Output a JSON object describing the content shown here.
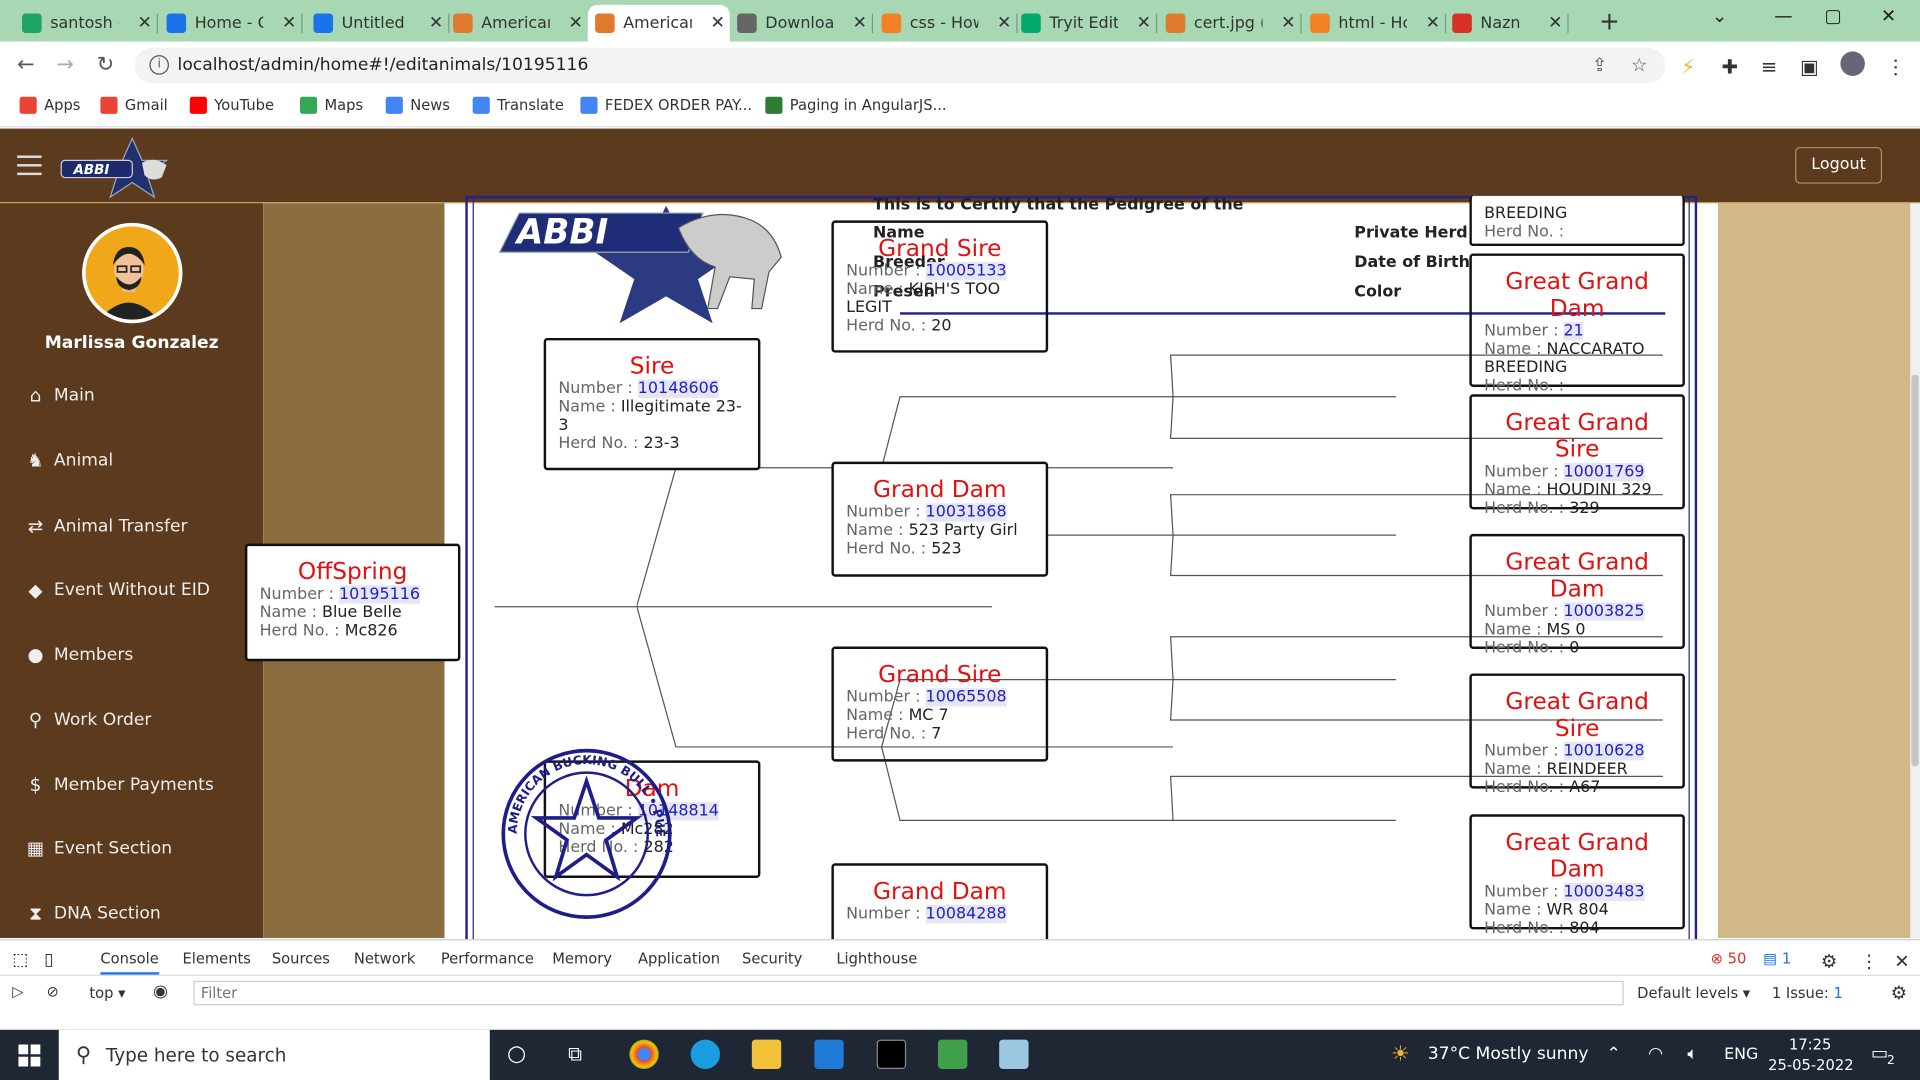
{
  "browser": {
    "tabs": [
      {
        "title": "santosh c",
        "favicon_color": "#1ea362",
        "active": false
      },
      {
        "title": "Home - C",
        "favicon_color": "#1a73e8",
        "active": false
      },
      {
        "title": "Untitled c",
        "favicon_color": "#1a73e8",
        "active": false
      },
      {
        "title": "American",
        "favicon_color": "#e07a2e",
        "active": false
      },
      {
        "title": "American",
        "favicon_color": "#e07a2e",
        "active": true
      },
      {
        "title": "Downloa",
        "favicon_color": "#666666",
        "active": false
      },
      {
        "title": "css - How",
        "favicon_color": "#f48024",
        "active": false
      },
      {
        "title": "Tryit Edit",
        "favicon_color": "#04aa6d",
        "active": false
      },
      {
        "title": "cert.jpg (",
        "favicon_color": "#e07a2e",
        "active": false
      },
      {
        "title": "html - Hc",
        "favicon_color": "#f48024",
        "active": false
      },
      {
        "title": "Nazn",
        "favicon_color": "#d93025",
        "active": false
      }
    ],
    "new_tab": "+",
    "url": "localhost/admin/home#!/editanimals/10195116",
    "bookmarks": [
      {
        "label": "Apps",
        "color": "#ea4335"
      },
      {
        "label": "Gmail",
        "color": "#ea4335"
      },
      {
        "label": "YouTube",
        "color": "#ff0000"
      },
      {
        "label": "Maps",
        "color": "#34a853"
      },
      {
        "label": "News",
        "color": "#4285f4"
      },
      {
        "label": "Translate",
        "color": "#4285f4"
      },
      {
        "label": "FEDEX ORDER PAY...",
        "color": "#4285f4"
      },
      {
        "label": "Paging in AngularJS...",
        "color": "#2e7d32"
      }
    ]
  },
  "app": {
    "logout_label": "Logout",
    "user_name": "Marlissa Gonzalez",
    "menu": [
      {
        "label": "Main",
        "icon": "home-icon",
        "glyph": "⌂"
      },
      {
        "label": "Animal",
        "icon": "horse-icon",
        "glyph": "♞"
      },
      {
        "label": "Animal Transfer",
        "icon": "transfer-icon",
        "glyph": "⇄"
      },
      {
        "label": "Event Without EID",
        "icon": "tag-icon",
        "glyph": "◆"
      },
      {
        "label": "Members",
        "icon": "users-icon",
        "glyph": "●"
      },
      {
        "label": "Work Order",
        "icon": "search-icon",
        "glyph": "⚲"
      },
      {
        "label": "Member Payments",
        "icon": "dollar-icon",
        "glyph": "$"
      },
      {
        "label": "Event Section",
        "icon": "calendar-icon",
        "glyph": "▦"
      },
      {
        "label": "DNA Section",
        "icon": "hourglass-icon",
        "glyph": "⧗"
      }
    ],
    "colors": {
      "brand": "#5b3a1d",
      "accent_red": "#e31010",
      "number_blue": "#2020cc"
    }
  },
  "certificate": {
    "header_certify": "This is to Certify that the Pedigree of the",
    "labels": {
      "name": "Name",
      "breeder": "Breeder",
      "present": "Presen",
      "private_herd": "Private Herd No.",
      "dob": "Date of Birth",
      "color": "Color"
    },
    "field_labels": {
      "number": "Number : ",
      "name": "Name : ",
      "herd": "Herd No. : "
    },
    "top_right_partial": {
      "breeding": "BREEDING",
      "herd": "Herd No. :"
    },
    "offspring": {
      "title": "OffSpring",
      "number": "10195116",
      "name": "Blue Belle",
      "herd": "Mc826"
    },
    "sire": {
      "title": "Sire",
      "number": "10148606",
      "name": "Illegitimate 23-3",
      "herd": "23-3"
    },
    "dam": {
      "title": "Dam",
      "number": "10148814",
      "name": "Mc282",
      "herd": "282"
    },
    "grand_sire_1": {
      "title": "Grand Sire",
      "number": "10005133",
      "name": "KISH'S TOO LEGIT",
      "herd": "20"
    },
    "grand_dam_1": {
      "title": "Grand Dam",
      "number": "10031868",
      "name": "523 Party Girl",
      "herd": "523"
    },
    "grand_sire_2": {
      "title": "Grand Sire",
      "number": "10065508",
      "name": "MC 7",
      "herd": "7"
    },
    "grand_dam_2": {
      "title": "Grand Dam",
      "number": "10084288"
    },
    "ggd_1": {
      "title": "Great Grand Dam",
      "number": "21",
      "name": "NACCARATO BREEDING",
      "herd": ""
    },
    "ggs_1": {
      "title": "Great Grand Sire",
      "number": "10001769",
      "name": "HOUDINI 329",
      "herd": "329"
    },
    "ggd_2": {
      "title": "Great Grand Dam",
      "number": "10003825",
      "name": "MS 0",
      "herd": "0"
    },
    "ggs_2": {
      "title": "Great Grand Sire",
      "number": "10010628",
      "name": "REINDEER",
      "herd": "A67"
    },
    "ggd_3": {
      "title": "Great Grand Dam",
      "number": "10003483",
      "name": "WR 804",
      "herd": "804"
    },
    "stamp_text": "AMERICAN BUCKING BULL • PUEBLO, CO"
  },
  "devtools": {
    "tabs": [
      "Console",
      "Elements",
      "Sources",
      "Network",
      "Performance",
      "Memory",
      "Application",
      "Security",
      "Lighthouse"
    ],
    "errors": "50",
    "messages": "1",
    "context": "top",
    "filter_placeholder": "Filter",
    "levels": "Default levels",
    "issues": "1 Issue:",
    "issues_count": "1"
  },
  "taskbar": {
    "search_placeholder": "Type here to search",
    "weather": "37°C  Mostly sunny",
    "lang": "ENG",
    "time": "17:25",
    "date": "25-05-2022",
    "notifications": "2"
  }
}
